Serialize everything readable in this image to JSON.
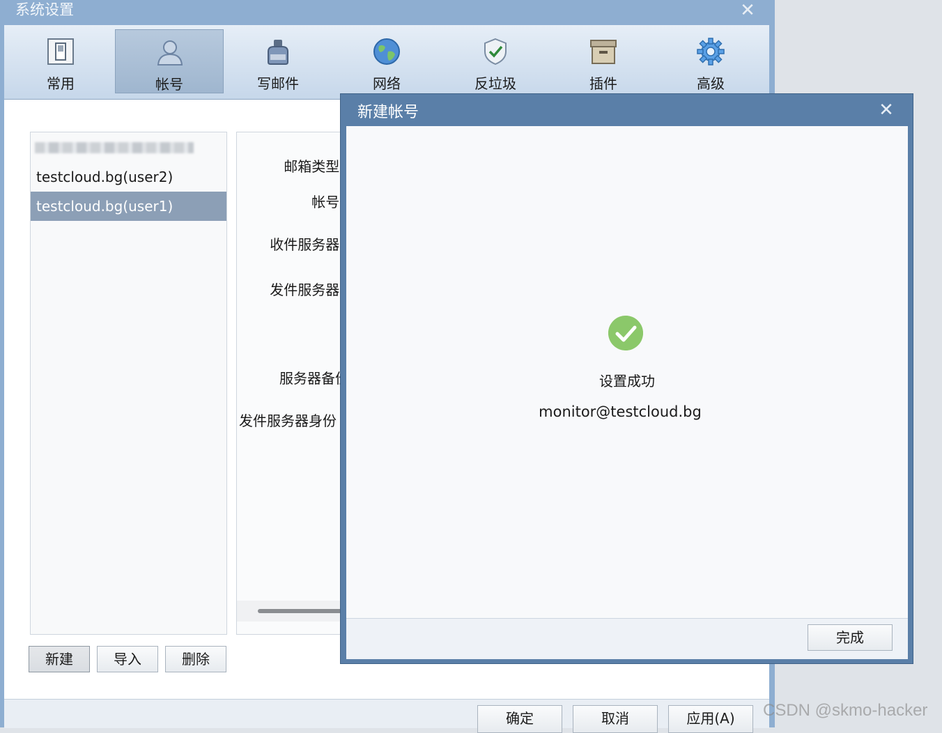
{
  "window": {
    "title": "系统设置"
  },
  "tabs": [
    {
      "label": "常用",
      "icon": "general-icon"
    },
    {
      "label": "帐号",
      "icon": "user-icon",
      "active": true
    },
    {
      "label": "写邮件",
      "icon": "ink-bottle-icon"
    },
    {
      "label": "网络",
      "icon": "globe-icon"
    },
    {
      "label": "反垃圾",
      "icon": "shield-check-icon"
    },
    {
      "label": "插件",
      "icon": "box-icon"
    },
    {
      "label": "高级",
      "icon": "gear-icon"
    }
  ],
  "accounts": {
    "items": [
      {
        "label": "testcloud.bg(user2)"
      },
      {
        "label": "testcloud.bg(user1)",
        "selected": true
      }
    ],
    "buttons": {
      "new": "新建",
      "import": "导入",
      "delete": "删除"
    }
  },
  "detail": {
    "labels": [
      "邮箱类型:",
      "帐号:",
      "收件服务器:",
      "发件服务器:",
      "服务器备份",
      "发件服务器身份"
    ]
  },
  "footer": {
    "ok": "确定",
    "cancel": "取消",
    "apply": "应用(A)"
  },
  "modal": {
    "title": "新建帐号",
    "status": "设置成功",
    "email": "monitor@testcloud.bg",
    "done": "完成"
  },
  "watermark": "CSDN @skmo-hacker",
  "colors": {
    "titlebar": "#8eaed1",
    "selected": "#8c9fb6",
    "success": "#8bc86a",
    "modal_frame": "#5a7fa8"
  }
}
